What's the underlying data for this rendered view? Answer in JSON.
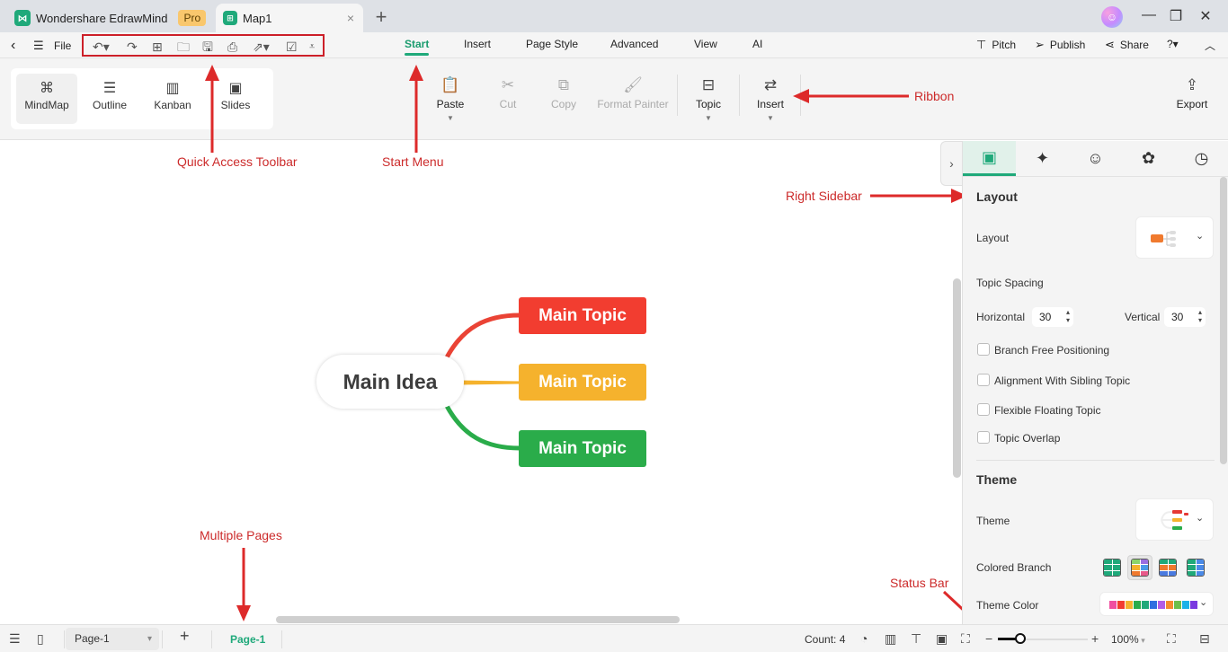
{
  "titlebar": {
    "app_tab": {
      "title": "Wondershare EdrawMind",
      "badge": "Pro",
      "icon": "edrawmind-logo-icon"
    },
    "doc_tab": {
      "title": "Map1",
      "icon": "mindmap-file-icon",
      "close": "×"
    },
    "new_tab": "+",
    "window_controls": {
      "minimize": "—",
      "restore": "❐",
      "close": "✕"
    },
    "avatar_icon": "user-avatar-icon"
  },
  "menubar": {
    "back": "‹",
    "hamburger": "☰",
    "file": "File",
    "quick_access": [
      {
        "name": "undo",
        "glyph": "↶▾"
      },
      {
        "name": "redo",
        "glyph": "↷"
      },
      {
        "name": "new",
        "glyph": "⊞"
      },
      {
        "name": "open",
        "glyph": "🗀"
      },
      {
        "name": "save",
        "glyph": "🖫"
      },
      {
        "name": "print",
        "glyph": "⎙"
      },
      {
        "name": "export",
        "glyph": "⇗▾"
      },
      {
        "name": "task",
        "glyph": "☑"
      },
      {
        "name": "customize",
        "glyph": "⩡"
      }
    ],
    "tabs": [
      "Start",
      "Insert",
      "Page Style",
      "Advanced",
      "View",
      "AI"
    ],
    "active_tab": "Start",
    "right": {
      "pitch": "Pitch",
      "publish": "Publish",
      "share": "Share",
      "help": "?▾",
      "collapse": "︿"
    }
  },
  "ribbon": {
    "views": [
      {
        "label": "MindMap",
        "icon": "mindmap-view-icon",
        "glyph": "⌘",
        "active": true
      },
      {
        "label": "Outline",
        "icon": "outline-view-icon",
        "glyph": "☰",
        "active": false
      },
      {
        "label": "Kanban",
        "icon": "kanban-view-icon",
        "glyph": "▥",
        "active": false
      },
      {
        "label": "Slides",
        "icon": "slides-view-icon",
        "glyph": "▣",
        "active": false
      }
    ],
    "buttons": [
      {
        "label": "Paste",
        "glyph": "📋",
        "disabled": false,
        "dropdown": true
      },
      {
        "label": "Cut",
        "glyph": "✂",
        "disabled": true,
        "dropdown": false
      },
      {
        "label": "Copy",
        "glyph": "⧉",
        "disabled": true,
        "dropdown": false
      },
      {
        "label": "Format Painter",
        "glyph": "🖌",
        "disabled": true,
        "dropdown": false
      },
      {
        "label": "Topic",
        "glyph": "⊟",
        "disabled": false,
        "dropdown": true
      },
      {
        "label": "Insert",
        "glyph": "⇄",
        "disabled": false,
        "dropdown": true
      }
    ],
    "export": {
      "label": "Export",
      "glyph": "⇪"
    }
  },
  "canvas": {
    "main_idea": "Main Idea",
    "topics": [
      {
        "label": "Main Topic",
        "color": "#f23d30"
      },
      {
        "label": "Main Topic",
        "color": "#f5b22d"
      },
      {
        "label": "Main Topic",
        "color": "#2aac4a"
      }
    ],
    "branch_colors": [
      "#ea4335",
      "#f5b22d",
      "#2aac4a"
    ]
  },
  "annotations": {
    "quick_access": "Quick Access Toolbar",
    "start_menu": "Start Menu",
    "ribbon": "Ribbon",
    "right_sidebar": "Right Sidebar",
    "multiple_pages": "Multiple Pages",
    "status_bar": "Status Bar",
    "color": "#cc2b2b"
  },
  "sidebar": {
    "tabs": [
      {
        "icon": "layout-panel-icon",
        "glyph": "▣",
        "active": true
      },
      {
        "icon": "ai-sparkle-icon",
        "glyph": "✦",
        "active": false
      },
      {
        "icon": "mark-icon",
        "glyph": "☺",
        "active": false
      },
      {
        "icon": "clipart-icon",
        "glyph": "✿",
        "active": false
      },
      {
        "icon": "history-icon",
        "glyph": "◷",
        "active": false
      }
    ],
    "collapse_glyph": "›",
    "layout_section": {
      "title": "Layout",
      "layout_label": "Layout",
      "topic_spacing": "Topic Spacing",
      "horizontal_label": "Horizontal",
      "horizontal_value": "30",
      "vertical_label": "Vertical",
      "vertical_value": "30",
      "checkboxes": [
        {
          "label": "Branch Free Positioning",
          "checked": false
        },
        {
          "label": "Alignment With Sibling Topic",
          "checked": false
        },
        {
          "label": "Flexible Floating Topic",
          "checked": false
        },
        {
          "label": "Topic Overlap",
          "checked": false
        }
      ]
    },
    "theme_section": {
      "title": "Theme",
      "theme_label": "Theme",
      "colored_branch_label": "Colored Branch",
      "colored_branch_selected": 1,
      "theme_color_label": "Theme Color",
      "theme_colors": [
        "#f04fa0",
        "#f23d30",
        "#f5b22d",
        "#2aac4a",
        "#1fa97a",
        "#2f6fe0",
        "#b25ce6",
        "#f58a2d",
        "#6cbf4a",
        "#1ab2e8",
        "#7a3ae0"
      ]
    }
  },
  "statusbar": {
    "page_select": "Page-1",
    "add_page": "+",
    "active_page": "Page-1",
    "count": "Count: 4",
    "zoom_value": "100%",
    "zoom_fraction": 0.25,
    "zoom_minus": "−",
    "zoom_plus": "+"
  }
}
